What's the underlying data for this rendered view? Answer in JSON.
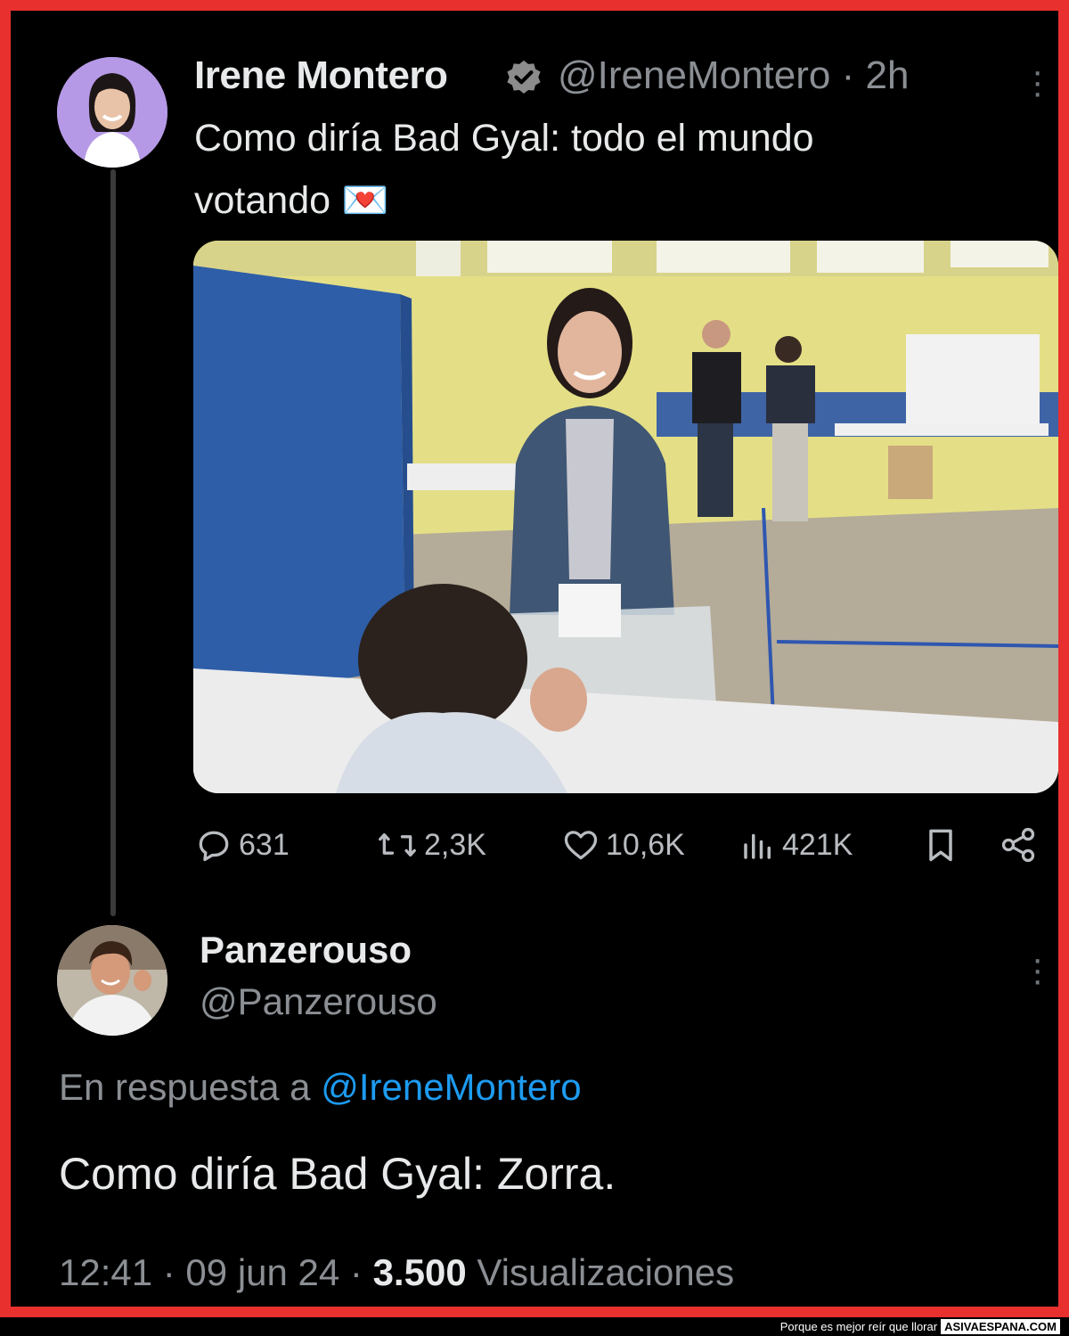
{
  "tweet": {
    "author_name": "Irene Montero",
    "handle": "@IreneMontero",
    "time": "· 2h",
    "text_line1": "Como diría Bad Gyal: todo el mundo",
    "text_line2": "votando 💌",
    "replies": "631",
    "retweets": "2,3K",
    "likes": "10,6K",
    "views": "421K"
  },
  "reply": {
    "author_name": "Panzerouso",
    "handle": "@Panzerouso",
    "reply_prefix": "En respuesta a",
    "reply_mention": "@IreneMontero",
    "text": "Como diría Bad Gyal: Zorra.",
    "time": "12:41 · 09 jun 24 ·",
    "views_count": "3.500",
    "views_label": "Visualizaciones"
  },
  "footer": {
    "tagline": "Porque es mejor reír que llorar",
    "site": "ASIVAESPANA.COM"
  },
  "colors": {
    "frame": "#e8302f",
    "background": "#000000",
    "link": "#1d9bf0",
    "muted": "#8b8f94"
  },
  "icons": [
    "verified-badge-icon",
    "more-icon",
    "reply-icon",
    "retweet-icon",
    "like-icon",
    "views-icon",
    "bookmark-icon",
    "share-icon"
  ]
}
